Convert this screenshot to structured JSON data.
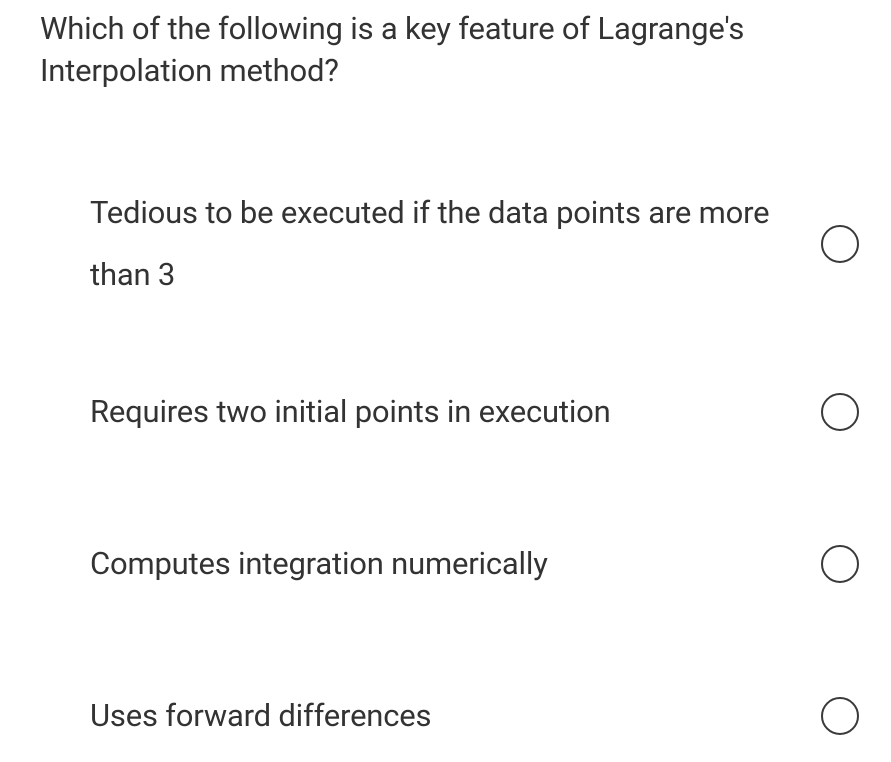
{
  "question": {
    "text": "Which of the following is a key feature of Lagrange's Interpolation method?"
  },
  "options": [
    {
      "label": "Tedious to be executed if the data points are more than 3"
    },
    {
      "label": "Requires two initial points in execution"
    },
    {
      "label": "Computes integration numerically"
    },
    {
      "label": "Uses forward differences"
    }
  ]
}
